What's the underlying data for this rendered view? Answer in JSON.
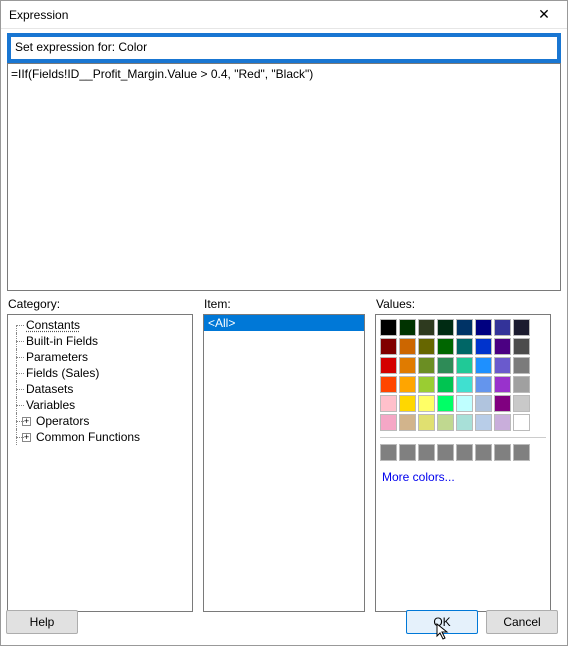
{
  "window": {
    "title": "Expression",
    "close_glyph": "✕"
  },
  "expression": {
    "label": "Set expression for: Color",
    "value": "=IIf(Fields!ID__Profit_Margin.Value > 0.4, \"Red\", \"Black\")"
  },
  "category": {
    "label": "Category:",
    "items": [
      {
        "label": "Constants",
        "selected": true
      },
      {
        "label": "Built-in Fields"
      },
      {
        "label": "Parameters"
      },
      {
        "label": "Fields (Sales)"
      },
      {
        "label": "Datasets"
      },
      {
        "label": "Variables"
      },
      {
        "label": "Operators",
        "expandable": true
      },
      {
        "label": "Common Functions",
        "expandable": true
      }
    ]
  },
  "item": {
    "label": "Item:",
    "selected": "<All>"
  },
  "values": {
    "label": "Values:",
    "more": "More colors...",
    "rows": [
      [
        "#000000",
        "#003300",
        "#2e3a1f",
        "#002b13",
        "#003366",
        "#000080",
        "#333399",
        "#1b1b2f"
      ],
      [
        "#800000",
        "#cc6600",
        "#666600",
        "#006600",
        "#006666",
        "#0033cc",
        "#4b0082",
        "#4c4c4c"
      ],
      [
        "#d40000",
        "#e07b00",
        "#6b8e23",
        "#2e8b57",
        "#20c997",
        "#1e90ff",
        "#6a5acd",
        "#7b7b7b"
      ],
      [
        "#ff4500",
        "#ffa500",
        "#9acd32",
        "#00c451",
        "#40e0d0",
        "#6495ed",
        "#9932cc",
        "#a0a0a0"
      ],
      [
        "#ffc0cb",
        "#ffd700",
        "#ffff66",
        "#00ff66",
        "#bfffff",
        "#b0c4de",
        "#800080",
        "#c9c9c9"
      ],
      [
        "#f5a7c6",
        "#d2b48c",
        "#e0e070",
        "#c0d890",
        "#a8e0d8",
        "#b8cde8",
        "#c9aedb",
        "#ffffff"
      ]
    ],
    "standard_count": 8
  },
  "buttons": {
    "help": "Help",
    "ok": "OK",
    "cancel": "Cancel"
  }
}
